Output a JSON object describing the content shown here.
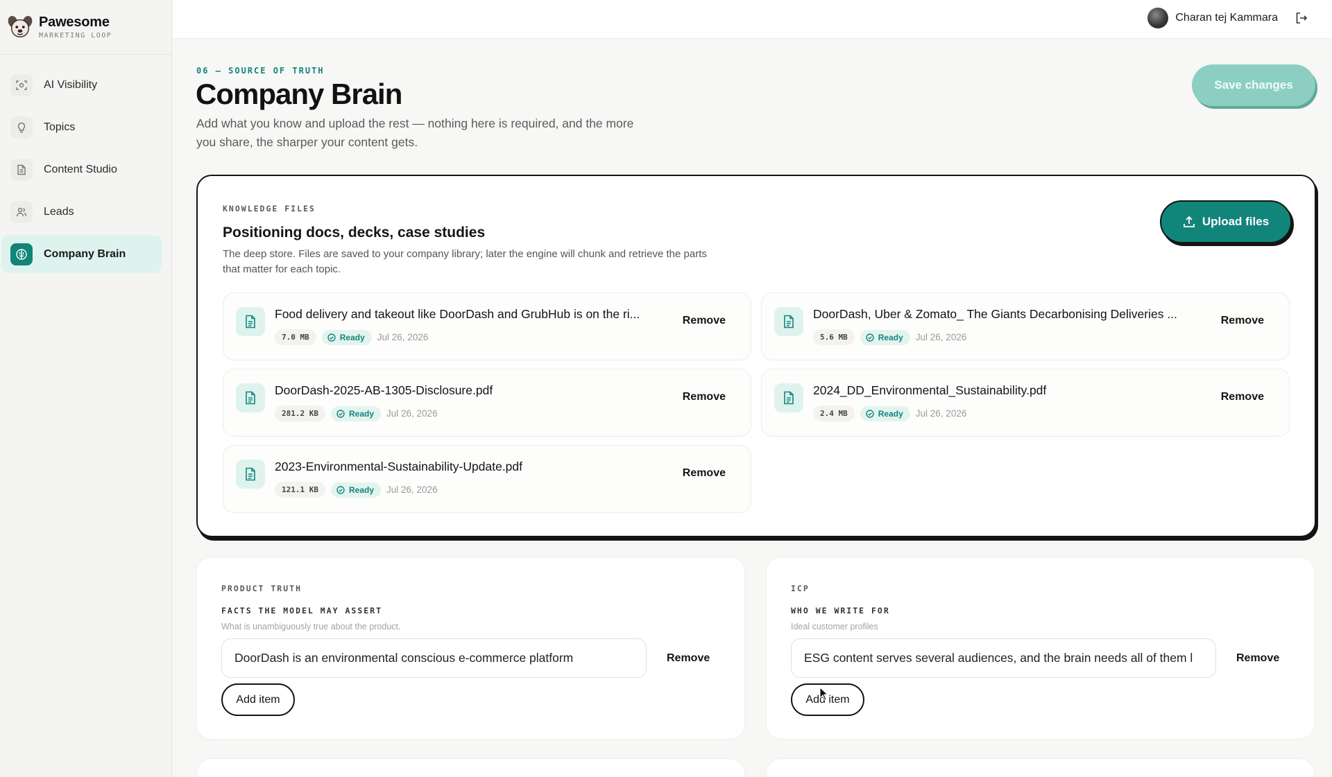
{
  "brand": {
    "name": "Pawesome",
    "subtitle": "MARKETING LOOP"
  },
  "sidebar": {
    "items": [
      {
        "label": "AI Visibility",
        "icon": "scan-icon",
        "active": false
      },
      {
        "label": "Topics",
        "icon": "lightbulb-icon",
        "active": false
      },
      {
        "label": "Content Studio",
        "icon": "document-icon",
        "active": false
      },
      {
        "label": "Leads",
        "icon": "users-icon",
        "active": false
      },
      {
        "label": "Company Brain",
        "icon": "brain-icon",
        "active": true
      }
    ]
  },
  "topbar": {
    "user_name": "Charan tej Kammara",
    "logout_icon": "logout-icon"
  },
  "header": {
    "eyebrow": "06 — SOURCE OF TRUTH",
    "title": "Company Brain",
    "description": "Add what you know and upload the rest — nothing here is required, and the more you share, the sharper your content gets.",
    "save_label": "Save changes"
  },
  "knowledge": {
    "eyebrow": "KNOWLEDGE FILES",
    "title": "Positioning docs, decks, case studies",
    "description": "The deep store. Files are saved to your company library; later the engine will chunk and retrieve the parts that matter for each topic.",
    "upload_label": "Upload files",
    "remove_label": "Remove",
    "files": [
      {
        "name": "Food delivery and takeout like DoorDash and GrubHub is on the ri...",
        "size": "7.0 MB",
        "status": "Ready",
        "date": "Jul 26, 2026"
      },
      {
        "name": "DoorDash, Uber & Zomato_ The Giants Decarbonising Deliveries ...",
        "size": "5.6 MB",
        "status": "Ready",
        "date": "Jul 26, 2026"
      },
      {
        "name": "DoorDash-2025-AB-1305-Disclosure.pdf",
        "size": "281.2 KB",
        "status": "Ready",
        "date": "Jul 26, 2026"
      },
      {
        "name": "2024_DD_Environmental_Sustainability.pdf",
        "size": "2.4 MB",
        "status": "Ready",
        "date": "Jul 26, 2026"
      },
      {
        "name": "2023-Environmental-Sustainability-Update.pdf",
        "size": "121.1 KB",
        "status": "Ready",
        "date": "Jul 26, 2026"
      }
    ]
  },
  "product_truth": {
    "eyebrow": "PRODUCT TRUTH",
    "subtitle": "FACTS THE MODEL MAY ASSERT",
    "hint": "What is unambiguously true about the product.",
    "items": [
      "DoorDash is an environmental conscious e-commerce platform"
    ],
    "remove_label": "Remove",
    "add_label": "Add item"
  },
  "icp": {
    "eyebrow": "ICP",
    "subtitle": "WHO WE WRITE FOR",
    "hint": "Ideal customer profiles",
    "items": [
      "ESG content serves several audiences, and the brain needs all of them l"
    ],
    "remove_label": "Remove",
    "add_label": "Add item"
  },
  "colors": {
    "accent": "#12857a",
    "accent_light": "#dff3ee",
    "save_disabled": "#8ccfc2"
  }
}
